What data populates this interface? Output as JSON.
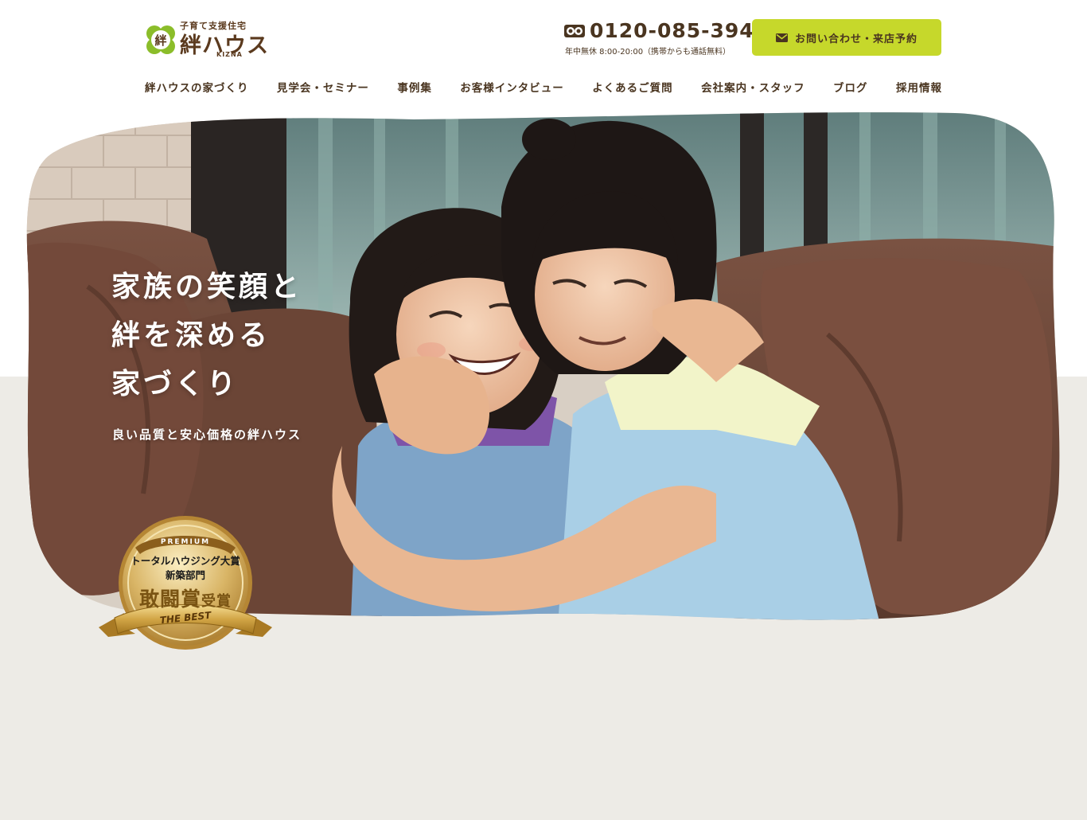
{
  "header": {
    "logo": {
      "tagline": "子育て支援住宅",
      "name": "絆ハウス",
      "sub": "KIZNA",
      "clover_char": "絆"
    },
    "phone": {
      "icon": "free-dial-icon",
      "number": "0120-085-394",
      "hours": "年中無休 8:00-20:00（携帯からも通話無料）"
    },
    "contact_button": {
      "icon": "mail-icon",
      "label": "お問い合わせ・来店予約"
    }
  },
  "nav": {
    "items": [
      {
        "label": "絆ハウスの家づくり"
      },
      {
        "label": "見学会・セミナー"
      },
      {
        "label": "事例集"
      },
      {
        "label": "お客様インタビュー"
      },
      {
        "label": "よくあるご質問"
      },
      {
        "label": "会社案内・スタッフ"
      },
      {
        "label": "ブログ"
      },
      {
        "label": "採用情報"
      }
    ]
  },
  "hero": {
    "title_lines": [
      "家族の笑顔と",
      "絆を深める",
      "家づくり"
    ],
    "subtitle": "良い品質と安心価格の絆ハウス",
    "image_subject": "two-girls-hugging-on-sofa-photo"
  },
  "award": {
    "premium": "PREMIUM",
    "line1": "トータルハウジング大賞",
    "line2": "新築部門",
    "line3_main": "敢闘賞",
    "line3_small": "受賞",
    "best": "THE BEST"
  },
  "colors": {
    "accent_green": "#c6d82b",
    "brown_text": "#4a3520",
    "lower_bg": "#edebe6",
    "sofa_brown": "#6e4a3a",
    "gold": "#c9a04a"
  }
}
